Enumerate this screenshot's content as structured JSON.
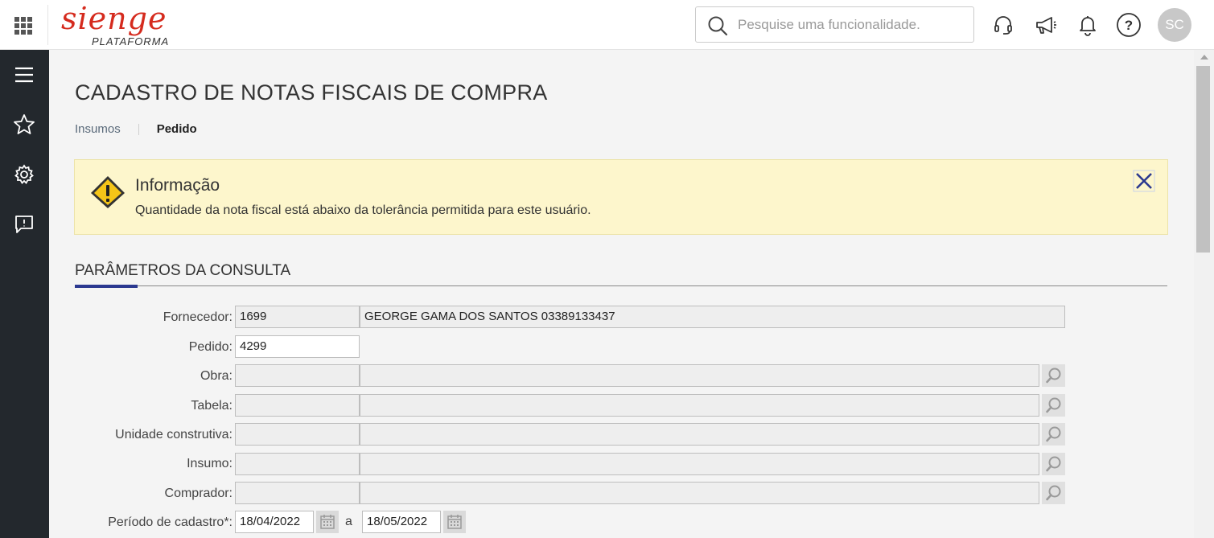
{
  "header": {
    "logo_text": "sienge",
    "logo_subtitle": "PLATAFORMA",
    "search_placeholder": "Pesquise uma funcionalidade.",
    "avatar_initials": "SC",
    "icons": [
      "apps-grid-icon",
      "search-icon",
      "headset-icon",
      "megaphone-icon",
      "bell-icon",
      "help-icon"
    ]
  },
  "sidebar": {
    "icons": [
      "menu-icon",
      "star-icon",
      "gear-icon",
      "feedback-icon"
    ]
  },
  "page": {
    "title": "CADASTRO DE NOTAS FISCAIS DE COMPRA",
    "breadcrumb": [
      {
        "label": "Insumos",
        "active": false
      },
      {
        "label": "Pedido",
        "active": true
      }
    ]
  },
  "alert": {
    "title": "Informação",
    "message": "Quantidade da nota fiscal está abaixo da tolerância permitida para este usuário.",
    "background": "#fdf6cc"
  },
  "section": {
    "title": "PARÂMETROS DA CONSULTA",
    "accent_color": "#2b3990"
  },
  "form": {
    "fornecedor": {
      "label": "Fornecedor:",
      "code": "1699",
      "name": "GEORGE GAMA DOS SANTOS 03389133437"
    },
    "pedido": {
      "label": "Pedido:",
      "value": "4299"
    },
    "obra": {
      "label": "Obra:",
      "code": "",
      "name": ""
    },
    "tabela": {
      "label": "Tabela:",
      "code": "",
      "name": ""
    },
    "unidade": {
      "label": "Unidade construtiva:",
      "code": "",
      "name": ""
    },
    "insumo": {
      "label": "Insumo:",
      "code": "",
      "name": ""
    },
    "comprador": {
      "label": "Comprador:",
      "code": "",
      "name": ""
    },
    "periodo": {
      "label": "Período de cadastro*:",
      "from": "18/04/2022",
      "separator": "a",
      "to": "18/05/2022"
    }
  }
}
